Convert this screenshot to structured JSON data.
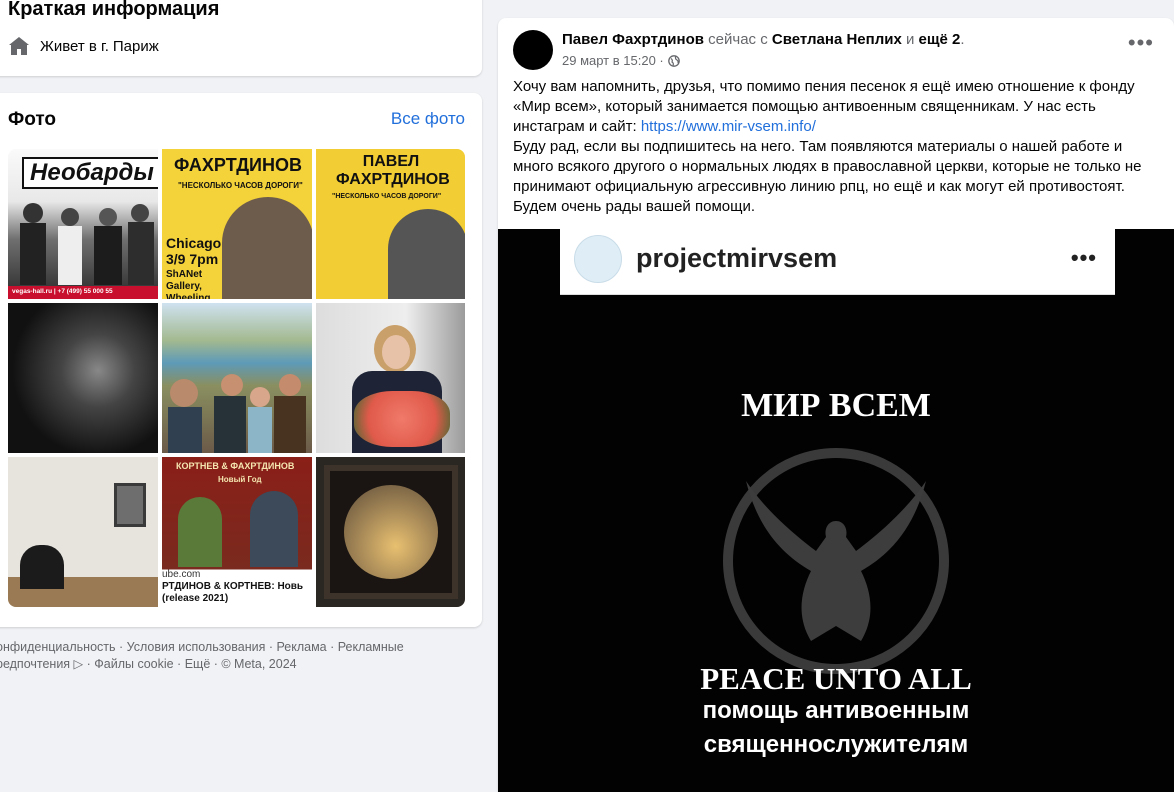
{
  "intro": {
    "title": "Краткая информация",
    "lives_prefix": "Живет в г.",
    "city": "Париж",
    "icon": "home-icon"
  },
  "photos": {
    "title": "Фото",
    "all_link": "Все фото",
    "items": [
      {
        "caption": "Необарды",
        "sub": "vegas-hall.ru | +7 (499) 55 000 55"
      },
      {
        "caption": "ФАХРТДИНОВ",
        "sub": "\"НЕСКОЛЬКО ЧАСОВ ДОРОГИ\"",
        "extra": "Chicago 3/9 7pm",
        "extra2": "ShANet Gallery, Wheeling"
      },
      {
        "caption": "ПАВЕЛ ФАХРТДИНОВ",
        "sub": "\"НЕСКОЛЬКО ЧАСОВ ДОРОГИ\""
      },
      {
        "caption": ""
      },
      {
        "caption": ""
      },
      {
        "caption": ""
      },
      {
        "caption": ""
      },
      {
        "caption": "КОРТНЕВ & ФАХРТДИНОВ",
        "sub": "Новый Год",
        "extra": "ube.com",
        "extra2": "РТДИНОВ & КОРТНЕВ: Новь",
        "extra3": "(release 2021)"
      },
      {
        "caption": ""
      }
    ]
  },
  "footer": {
    "text": "онфиденциальность · Условия использования · Реклама · Рекламные редпочтения ▷ · Файлы cookie · Ещё · © Meta, 2024"
  },
  "post": {
    "author": "Павел Фахртдинов",
    "now_with": "сейчас с",
    "tagged": "Светлана Неплих",
    "and": "и",
    "others": "ещё 2",
    "date": "29 март в 15:20 ·",
    "more": "•••",
    "text_line1": "Хочу вам напомнить, друзья, что помимо пения песенок я ещё имею отношение к фонду «Мир всем», который занимается помощью антивоенным священникам. У нас есть инстаграм и сайт: ",
    "link": "https://www.mir-vsem.info/",
    "text_line2": "Буду рад, если вы подпишитесь на него. Там появляются материалы о нашей работе и много всякого другого о нормальных людях в православной церкви, которые не только не принимают официальную агрессивную линию рпц, но ещё и как могут ей противостоят. Будем очень рады вашей помощи.",
    "image": {
      "ig_name": "projectmirvsem",
      "ig_more": "•••",
      "title": "МИР ВСЕМ",
      "peace": "PEACE UNTO ALL",
      "help1": "помощь антивоенным",
      "help2": "священнослужителям"
    }
  },
  "colors": {
    "background": "#f0f2f5",
    "link": "#216fdb",
    "secondary_text": "#65676b"
  }
}
